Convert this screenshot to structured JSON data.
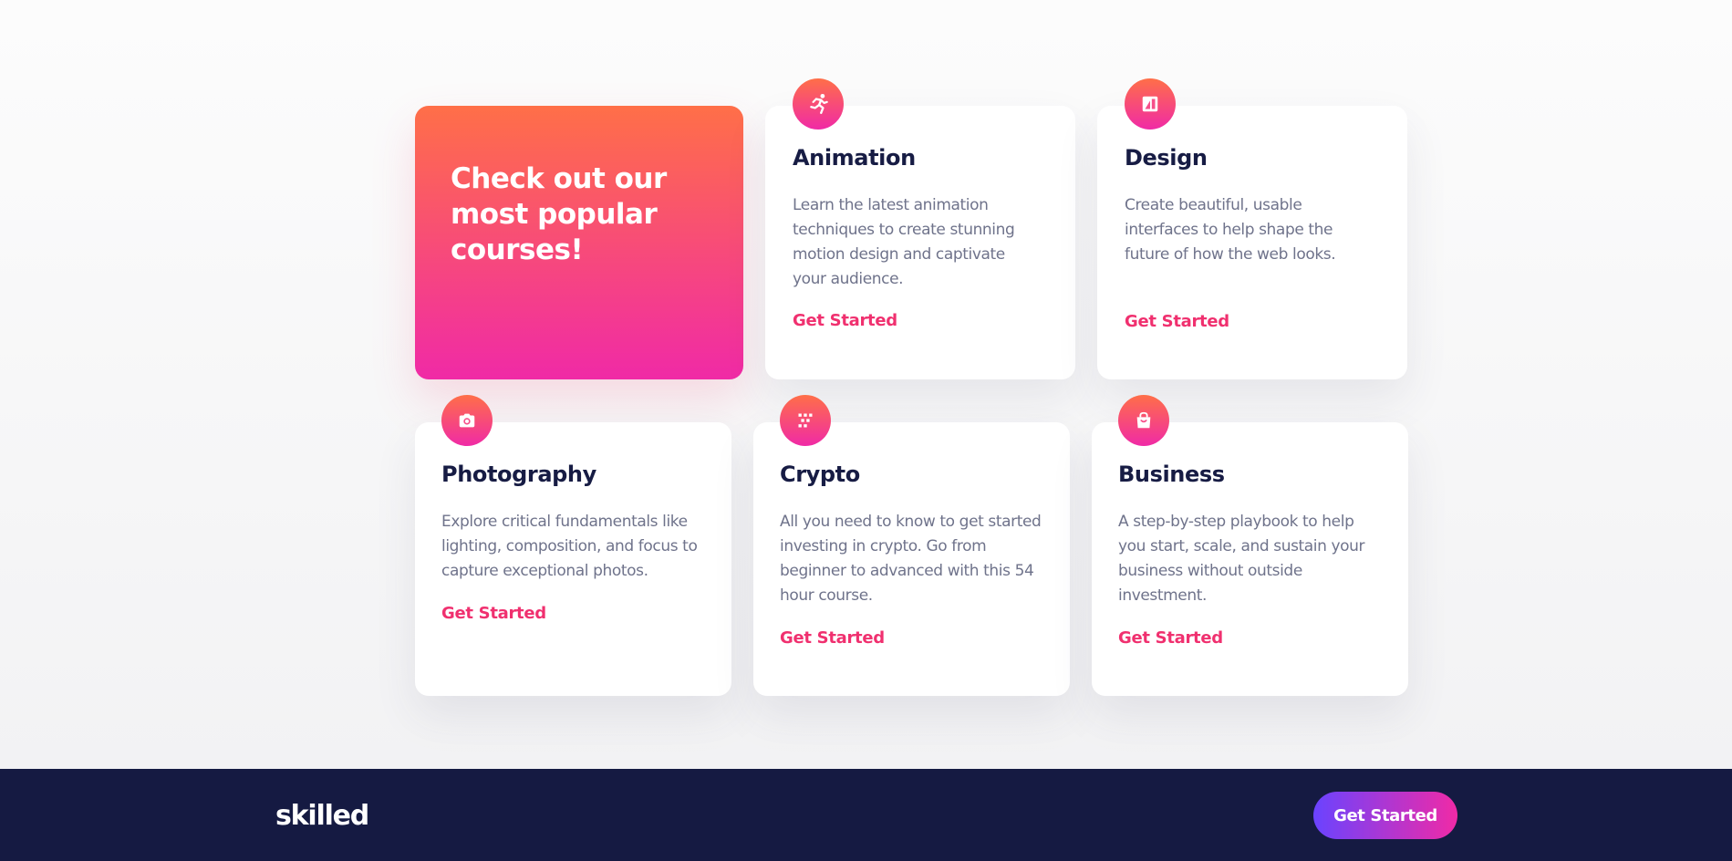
{
  "hero": {
    "title": "Check out our most popular courses!"
  },
  "courses": [
    {
      "title": "Animation",
      "description": "Learn the latest animation techniques to create stunning motion design and captivate your audience.",
      "cta": "Get Started",
      "icon": "animation-icon"
    },
    {
      "title": "Design",
      "description": "Create beautiful, usable interfaces to help shape the future of how the web looks.",
      "cta": "Get Started",
      "icon": "design-icon"
    },
    {
      "title": "Photography",
      "description": "Explore critical fundamentals like lighting, composition, and focus to capture exceptional photos.",
      "cta": "Get Started",
      "icon": "camera-icon"
    },
    {
      "title": "Crypto",
      "description": "All you need to know to get started investing in crypto. Go from beginner to advanced with this 54 hour course.",
      "cta": "Get Started",
      "icon": "crypto-icon"
    },
    {
      "title": "Business",
      "description": "A step-by-step playbook to help you start, scale, and sustain your business without outside investment.",
      "cta": "Get Started",
      "icon": "shopping-bag-icon"
    }
  ],
  "footer": {
    "logo": "skilled",
    "cta": "Get Started"
  },
  "colors": {
    "accent_start": "#ff6f48",
    "accent_end": "#f02aa6",
    "title": "#171c44",
    "body_text": "#6f738b",
    "link": "#f0306f",
    "footer_bg": "#151a42",
    "button_start": "#6a43ff"
  }
}
